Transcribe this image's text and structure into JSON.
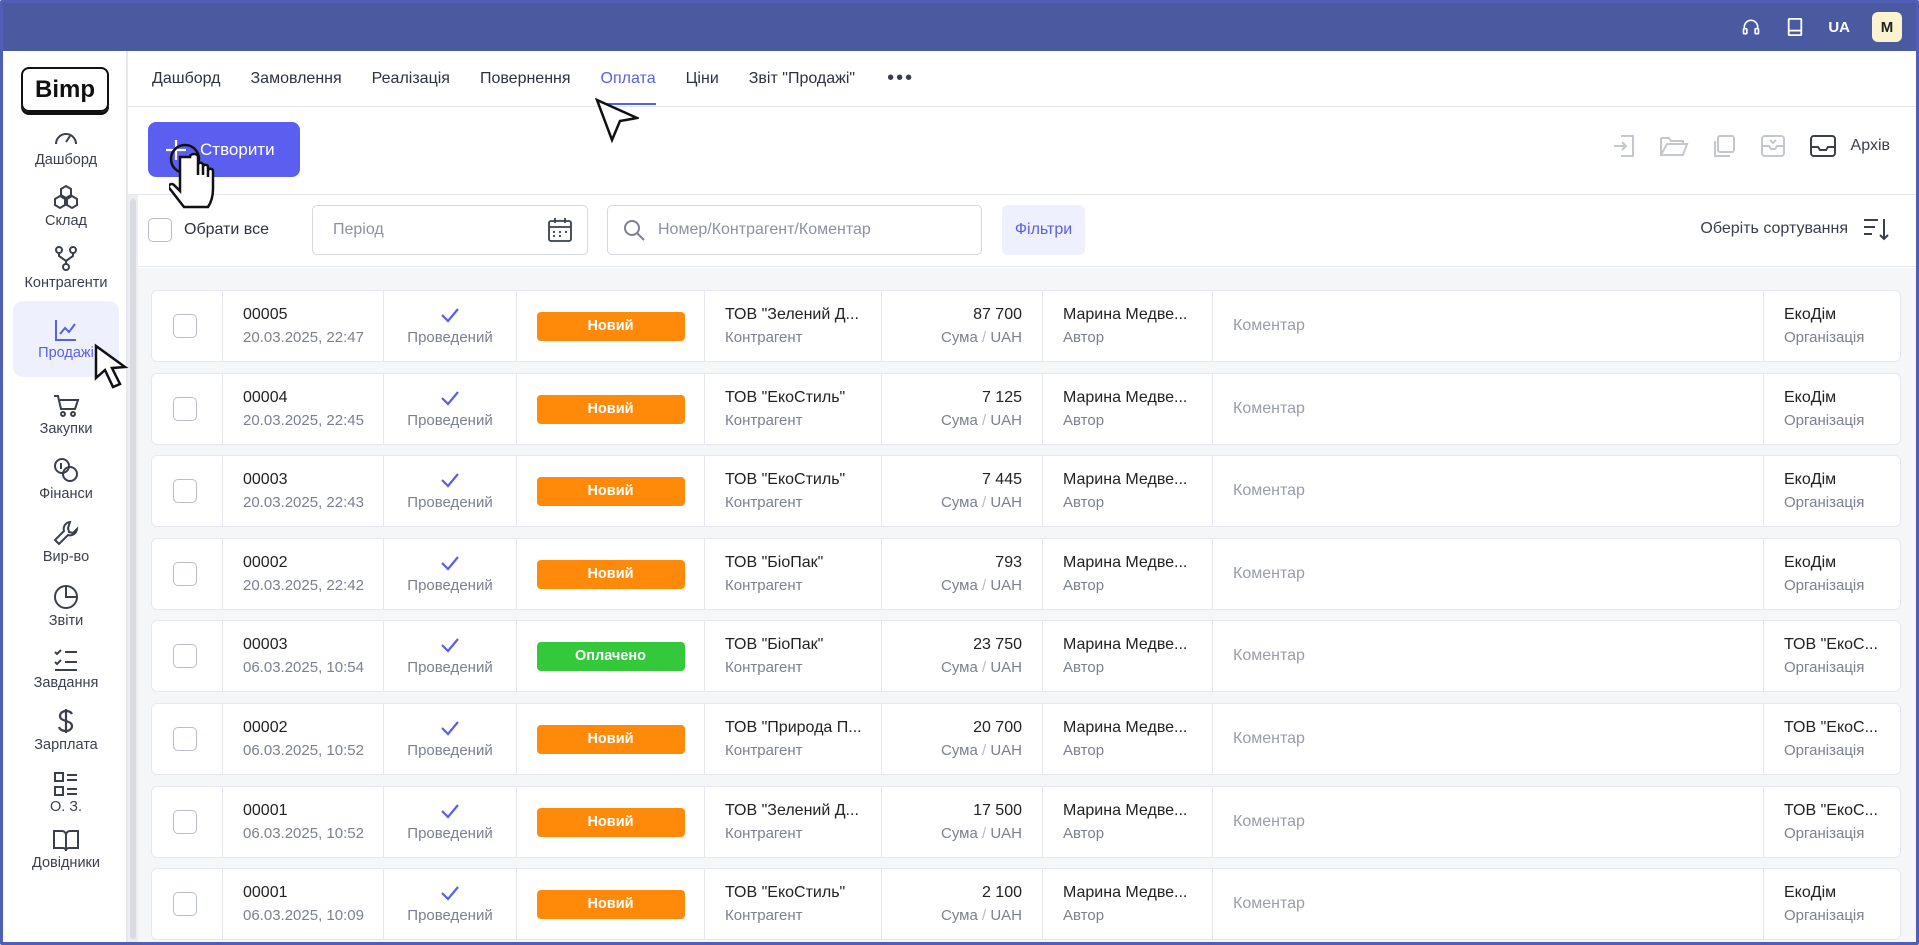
{
  "topbar": {
    "lang": "UA",
    "avatar": "M",
    "icons": [
      "headset-icon",
      "book-icon"
    ]
  },
  "logo": "Bimp",
  "sidebar": {
    "items": [
      {
        "label": "Дашборд",
        "icon": "gauge-icon"
      },
      {
        "label": "Склад",
        "icon": "boxes-icon"
      },
      {
        "label": "Контрагенти",
        "icon": "network-icon"
      },
      {
        "label": "Продажі",
        "icon": "chart-icon",
        "active": true
      },
      {
        "label": "Закупки",
        "icon": "cart-icon"
      },
      {
        "label": "Фінанси",
        "icon": "coins-icon"
      },
      {
        "label": "Вир-во",
        "icon": "wrench-icon"
      },
      {
        "label": "Звіти",
        "icon": "pie-icon"
      },
      {
        "label": "Завдання",
        "icon": "tasks-icon"
      },
      {
        "label": "Зарплата",
        "icon": "dollar-icon"
      },
      {
        "label": "О. З.",
        "icon": "assets-icon"
      },
      {
        "label": "Довідники",
        "icon": "open-book-icon"
      }
    ]
  },
  "tabs": [
    {
      "label": "Дашборд"
    },
    {
      "label": "Замовлення"
    },
    {
      "label": "Реалізація"
    },
    {
      "label": "Повернення"
    },
    {
      "label": "Оплата",
      "active": true
    },
    {
      "label": "Ціни"
    },
    {
      "label": "Звіт \"Продажі\""
    }
  ],
  "toolbar": {
    "create_label": "Створити",
    "archive_label": "Архів"
  },
  "filters": {
    "select_all": "Обрати все",
    "period_placeholder": "Період",
    "search_placeholder": "Номер/Контрагент/Коментар",
    "filters_label": "Фільтри",
    "sort_label": "Оберіть сортування"
  },
  "labels": {
    "status": "Проведений",
    "counterparty": "Контрагент",
    "sum": "Сума",
    "currency": "UAH",
    "author": "Автор",
    "comment": "Коментар",
    "organization": "Організація"
  },
  "rows": [
    {
      "number": "00005",
      "date": "20.03.2025, 22:47",
      "badge": "Новий",
      "badge_type": "new",
      "counterparty": "ТОВ \"Зелений Д...",
      "sum": "87 700",
      "author": "Марина Медве...",
      "org": "ЕкоДім"
    },
    {
      "number": "00004",
      "date": "20.03.2025, 22:45",
      "badge": "Новий",
      "badge_type": "new",
      "counterparty": "ТОВ \"ЕкоСтиль\"",
      "sum": "7 125",
      "author": "Марина Медве...",
      "org": "ЕкоДім"
    },
    {
      "number": "00003",
      "date": "20.03.2025, 22:43",
      "badge": "Новий",
      "badge_type": "new",
      "counterparty": "ТОВ \"ЕкоСтиль\"",
      "sum": "7 445",
      "author": "Марина Медве...",
      "org": "ЕкоДім"
    },
    {
      "number": "00002",
      "date": "20.03.2025, 22:42",
      "badge": "Новий",
      "badge_type": "new",
      "counterparty": "ТОВ \"БіоПак\"",
      "sum": "793",
      "author": "Марина Медве...",
      "org": "ЕкоДім"
    },
    {
      "number": "00003",
      "date": "06.03.2025, 10:54",
      "badge": "Оплачено",
      "badge_type": "paid",
      "counterparty": "ТОВ \"БіоПак\"",
      "sum": "23 750",
      "author": "Марина Медве...",
      "org": "ТОВ \"ЕкоС..."
    },
    {
      "number": "00002",
      "date": "06.03.2025, 10:52",
      "badge": "Новий",
      "badge_type": "new",
      "counterparty": "ТОВ \"Природа П...",
      "sum": "20 700",
      "author": "Марина Медве...",
      "org": "ТОВ \"ЕкоС..."
    },
    {
      "number": "00001",
      "date": "06.03.2025, 10:52",
      "badge": "Новий",
      "badge_type": "new",
      "counterparty": "ТОВ \"Зелений Д...",
      "sum": "17 500",
      "author": "Марина Медве...",
      "org": "ТОВ \"ЕкоС..."
    },
    {
      "number": "00001",
      "date": "06.03.2025, 10:09",
      "badge": "Новий",
      "badge_type": "new",
      "counterparty": "ТОВ \"ЕкоСтиль\"",
      "sum": "2 100",
      "author": "Марина Медве...",
      "org": "ЕкоДім"
    }
  ],
  "colors": {
    "topbar": "#4a5aa0",
    "accent": "#5b5ff0",
    "badge_new": "#ff8a0a",
    "badge_paid": "#34c83b"
  }
}
